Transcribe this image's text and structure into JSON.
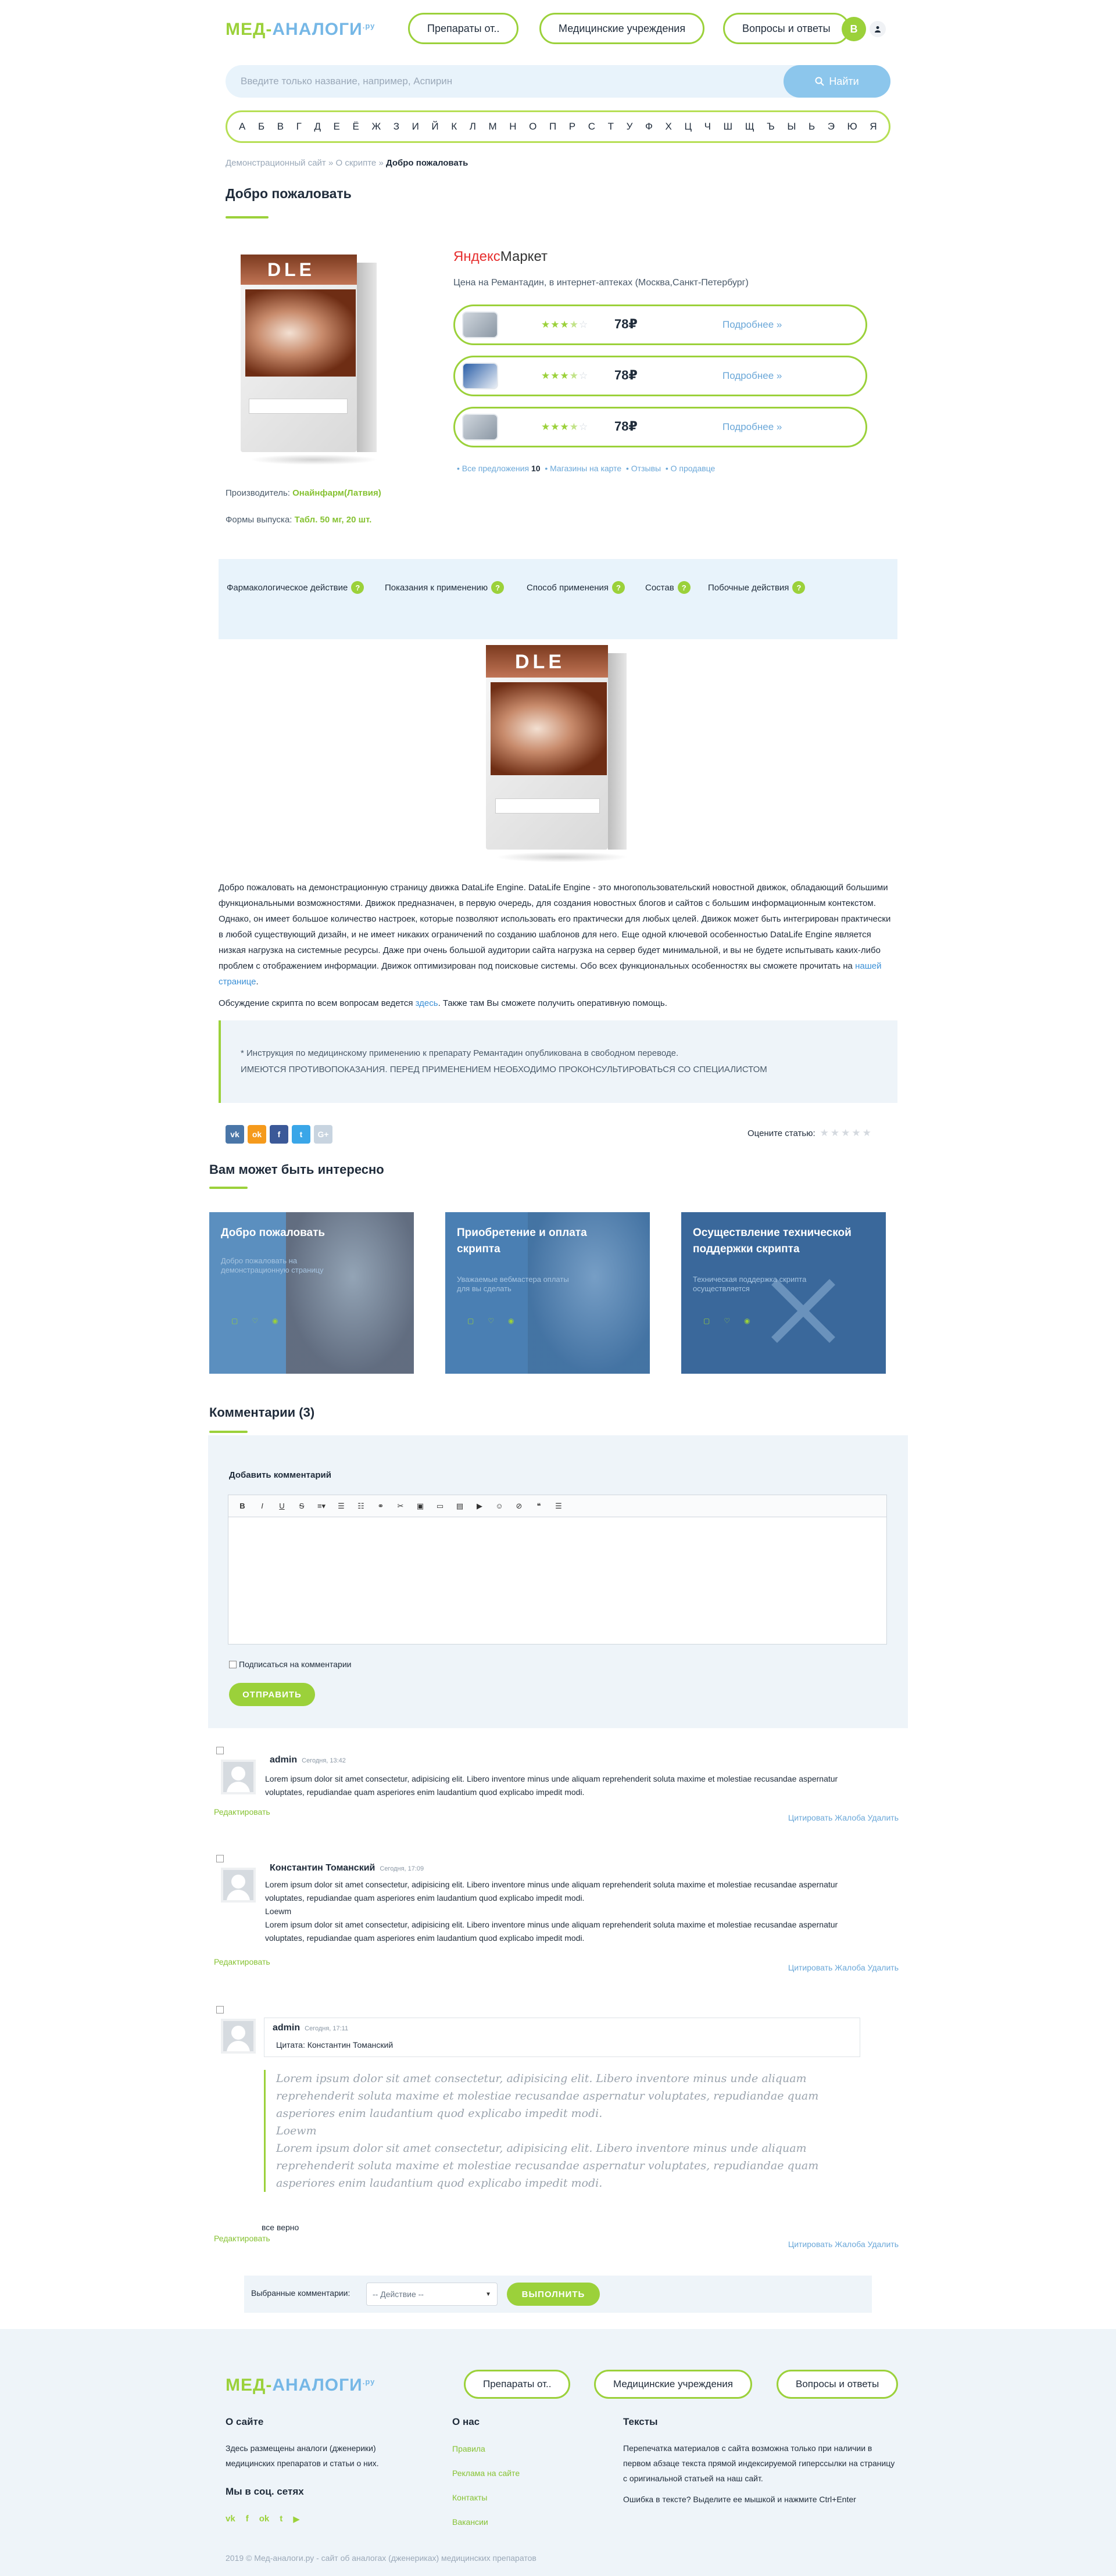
{
  "header": {
    "logo_part1": "МЕД-",
    "logo_part2": "АНАЛОГИ",
    "logo_sup": ".ру",
    "nav": [
      "Препараты от..",
      "Медицинские учреждения",
      "Вопросы и ответы"
    ],
    "avatar_letter": "В"
  },
  "search": {
    "placeholder": "Введите только название, например, Аспирин",
    "button": "Найти"
  },
  "alphabet": [
    "А",
    "Б",
    "В",
    "Г",
    "Д",
    "Е",
    "Ё",
    "Ж",
    "З",
    "И",
    "Й",
    "К",
    "Л",
    "М",
    "Н",
    "О",
    "П",
    "Р",
    "С",
    "Т",
    "У",
    "Ф",
    "Х",
    "Ц",
    "Ч",
    "Ш",
    "Щ",
    "Ъ",
    "Ы",
    "Ь",
    "Э",
    "Ю",
    "Я"
  ],
  "breadcrumb": {
    "home": "Демонстрационный сайт",
    "sep": " » ",
    "section": "О скрипте",
    "current": "Добро пожаловать"
  },
  "page_title": "Добро пожаловать",
  "market": {
    "logo_a": "Яндекс",
    "logo_b": "Маркет",
    "subtitle": "Цена на Ремантадин, в интернет-аптеках (Москва,Санкт-Петербург)",
    "offers": [
      {
        "stars": 3.5,
        "price": "78₽",
        "more": "Подробнее »"
      },
      {
        "stars": 3.5,
        "price": "78₽",
        "more": "Подробнее »"
      },
      {
        "stars": 3.5,
        "price": "78₽",
        "more": "Подробнее »"
      }
    ],
    "links": {
      "all_prefix": "• Все предложения",
      "all_count": "10",
      "shops": "• Магазины на карте",
      "reviews": "• Отзывы",
      "about": "• О продавце"
    }
  },
  "product_meta": {
    "manufacturer_label": "Производитель:",
    "manufacturer": "Онайнфарм(Латвия)",
    "forms_label": "Формы выпуска:",
    "forms": "Табл. 50 мг, 20 шт."
  },
  "tabs": [
    "Фармакологическое действие",
    "Показания к применению",
    "Способ применения",
    "Состав",
    "Побочные действия"
  ],
  "article": {
    "paragraph": "Добро пожаловать на демонстрационную страницу движка DataLife Engine. DataLife Engine - это многопользовательский новостной движок, обладающий большими функциональными возможностями. Движок предназначен, в первую очередь, для создания новостных блогов и сайтов с большим информационным контекстом. Однако, он имеет большое количество настроек, которые позволяют использовать его практически для любых целей. Движок может быть интегрирован практически в любой существующий дизайн, и не имеет никаких ограничений по созданию шаблонов для него. Еще одной ключевой особенностью DataLife Engine является низкая нагрузка на системные ресурсы. Даже при очень большой аудитории сайта нагрузка на сервер будет минимальной, и вы не будете испытывать каких-либо проблем с отображением информации. Движок оптимизирован под поисковые системы. Обо всех функциональных особенностях вы сможете прочитать на",
    "link": "нашей странице",
    "end": ".",
    "discuss_a": "Обсуждение скрипта по всем вопросам ведется ",
    "discuss_link": "здесь",
    "discuss_b": ". Также там Вы сможете получить оперативную помощь."
  },
  "notice": {
    "line1": "* Инструкция по медицинскому применению к препарату Ремантадин опубликована в свободном переводе.",
    "line2": "ИМЕЮТСЯ ПРОТИВОПОКАЗАНИЯ. ПЕРЕД ПРИМЕНЕНИЕМ НЕОБХОДИМО ПРОКОНСУЛЬТИРОВАТЬСЯ СО СПЕЦИАЛИСТОМ"
  },
  "share": {
    "vk": "vk",
    "ok": "ok",
    "fb": "f",
    "tw": "t",
    "gp": "G+"
  },
  "rating": {
    "label": "Оцените статью:",
    "stars": "★★★★★"
  },
  "interesting": {
    "title": "Вам может быть интересно",
    "cards": [
      {
        "title": "Добро пожаловать",
        "desc": "Добро пожаловать на демонстрационную страницу",
        "color": "#5b8fbf"
      },
      {
        "title": "Приобретение и оплата скрипта",
        "desc": "Уважаемые вебмастера оплаты для вы сделать",
        "color": "#4a7fb3"
      },
      {
        "title": "Осуществление технической поддержки скрипта",
        "desc": "Техническая поддержка скрипта осуществляется",
        "color": "#3a689b"
      }
    ]
  },
  "comments": {
    "title": "Комментарии (3)",
    "add_label": "Добавить комментарий",
    "subscribe": "Подписаться на комментарии",
    "send": "ОТПРАВИТЬ",
    "edit": "Редактировать",
    "actions": "Цитировать Жалоба Удалить",
    "items": [
      {
        "author": "admin",
        "date": "Сегодня, 13:42",
        "text": "Lorem ipsum dolor sit amet consectetur, adipisicing elit. Libero inventore minus unde aliquam reprehenderit soluta maxime et molestiae recusandae aspernatur voluptates, repudiandae quam asperiores enim laudantium quod explicabo impedit modi."
      },
      {
        "author": "Константин Томанский",
        "date": "Сегодня, 17:09",
        "text": "Lorem ipsum dolor sit amet consectetur, adipisicing elit. Libero inventore minus unde aliquam reprehenderit soluta maxime et molestiae recusandae aspernatur voluptates, repudiandae quam asperiores enim laudantium quod explicabo impedit modi.",
        "text2": "Loewm",
        "text3": "Lorem ipsum dolor sit amet consectetur, adipisicing elit. Libero inventore minus unde aliquam reprehenderit soluta maxime et molestiae recusandae aspernatur voluptates, repudiandae quam asperiores enim laudantium quod explicabo impedit modi."
      },
      {
        "author": "admin",
        "date": "Сегодня, 17:11",
        "quote_head": "Цитата: Константин Томанский",
        "quote1": "Lorem ipsum dolor sit amet consectetur, adipisicing elit. Libero inventore minus unde aliquam reprehenderit soluta maxime et molestiae recusandae aspernatur voluptates, repudiandae quam asperiores enim laudantium quod explicabo impedit modi.",
        "quote2": "Loewm",
        "quote3": "Lorem ipsum dolor sit amet consectetur, adipisicing elit. Libero inventore minus unde aliquam reprehenderit soluta maxime et molestiae recusandae aspernatur voluptates, repudiandae quam asperiores enim laudantium quod explicabo impedit modi.",
        "text": "все верно"
      }
    ]
  },
  "mass_action": {
    "label": "Выбранные комментарии:",
    "select": "-- Действие --",
    "button": "ВЫПОЛНИТЬ"
  },
  "footer": {
    "about_title": "О сайте",
    "about_text": "Здесь размещены аналоги (дженерики) медицинских препаратов и статьи о них.",
    "social_title": "Мы в соц. сетях",
    "us_title": "О нас",
    "us_links": [
      "Правила",
      "Реклама на сайте",
      "Контакты",
      "Вакансии"
    ],
    "texts_title": "Тексты",
    "texts_1": "Перепечатка материалов с сайта возможна только при наличии в первом абзаце текста прямой индексируемой гиперссылки на страницу с оригинальной статьей на наш сайт.",
    "texts_2": "Ошибка в тексте? Выделите ее мышкой и нажмите Ctrl+Enter",
    "copyright": "2019 ©   Мед-аналоги.ру - сайт об аналогах (дженериках) медицинских препаратов"
  }
}
